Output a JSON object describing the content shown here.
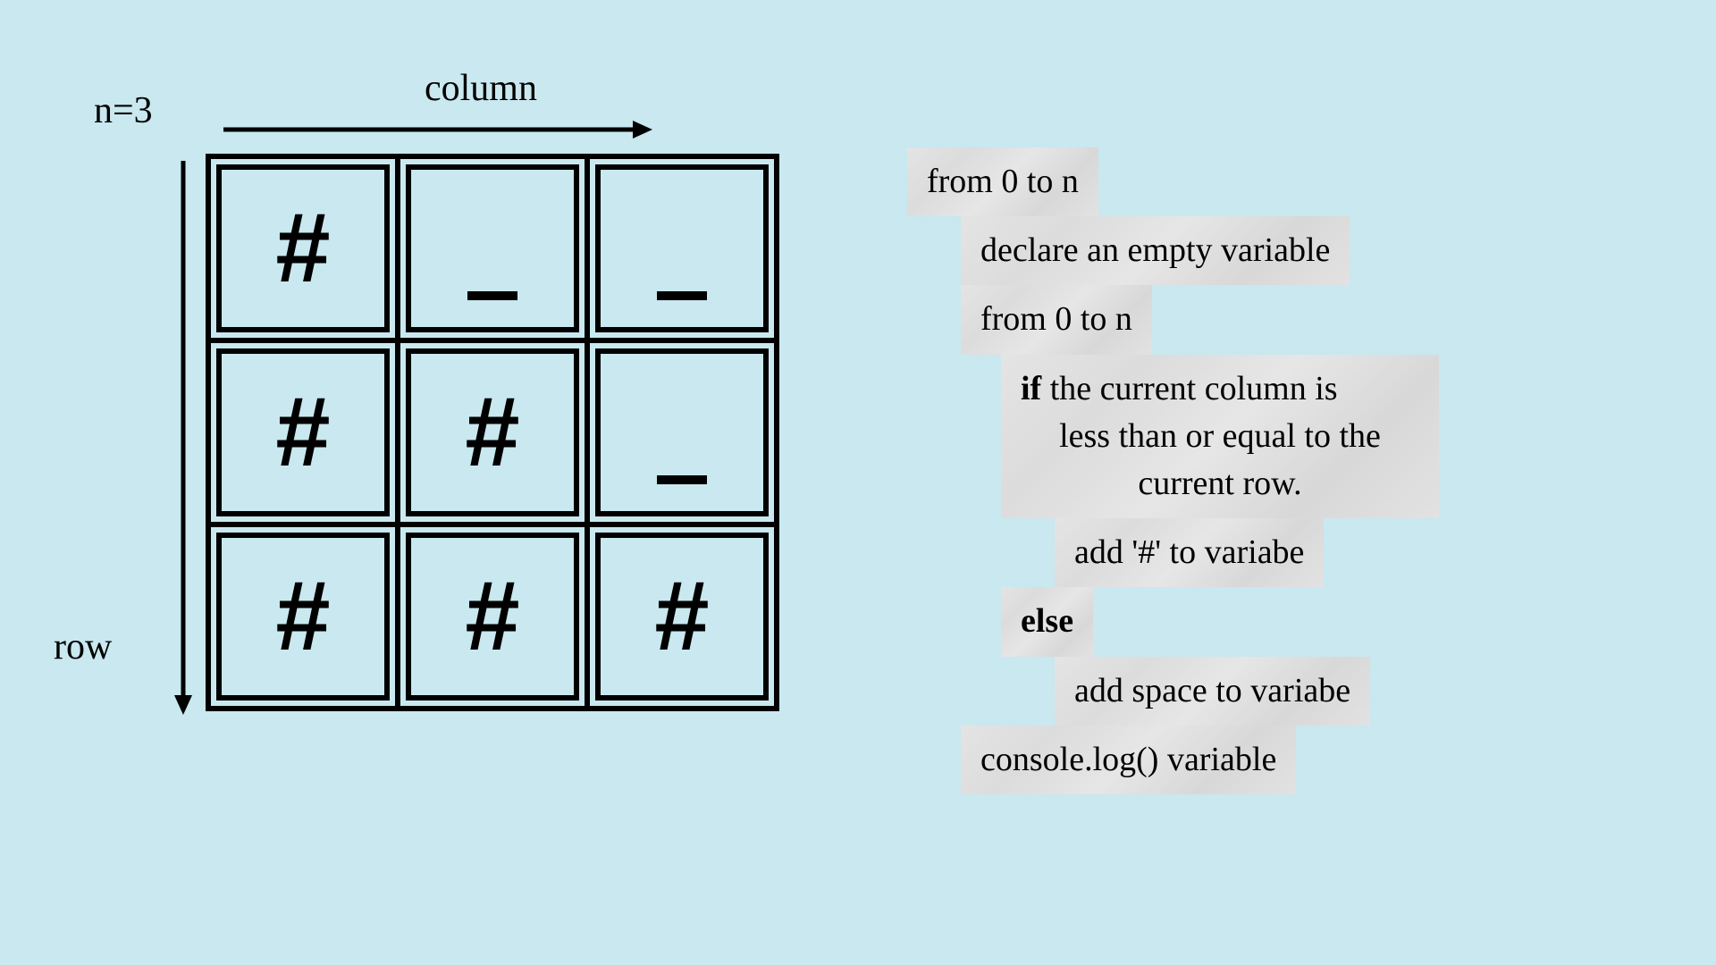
{
  "labels": {
    "n": "n=3",
    "column": "column",
    "row": "row"
  },
  "grid": {
    "size": 3,
    "rows": [
      [
        "#",
        "_",
        "_"
      ],
      [
        "#",
        "#",
        "_"
      ],
      [
        "#",
        "#",
        "#"
      ]
    ]
  },
  "pseudocode": {
    "line1": "from 0 to n",
    "line2": "declare an empty variable",
    "line3": "from 0 to n",
    "line4_if": "if",
    "line4_rest_a": " the current column is",
    "line4_rest_b": "less than or equal to the",
    "line4_rest_c": "current row.",
    "line5": "add '#' to variabe",
    "line6": "else",
    "line7": "add space to variabe",
    "line8": "console.log() variable"
  }
}
